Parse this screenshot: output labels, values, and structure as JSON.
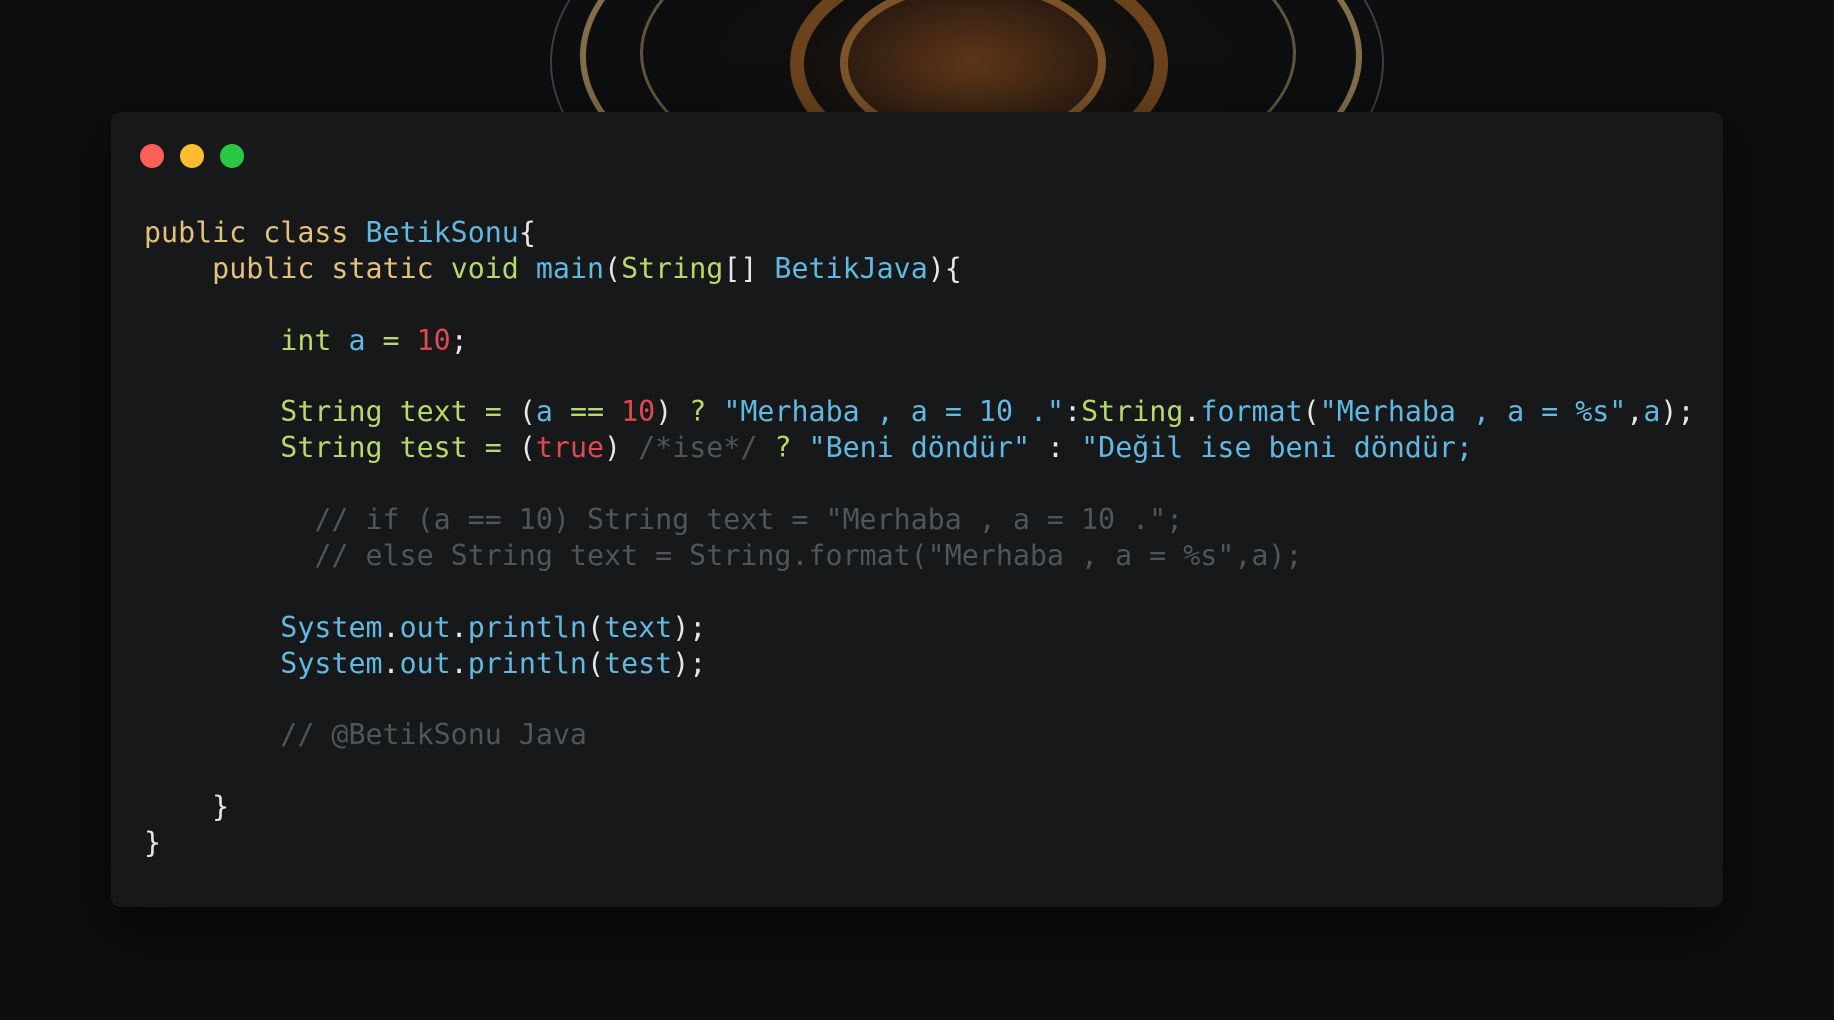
{
  "code_lines": [
    [
      [
        "kw",
        "public"
      ],
      [
        "pl",
        " "
      ],
      [
        "kw",
        "class"
      ],
      [
        "pl",
        " "
      ],
      [
        "id",
        "BetikSonu"
      ],
      [
        "pl",
        "{"
      ]
    ],
    [
      [
        "pl",
        "    "
      ],
      [
        "kw",
        "public"
      ],
      [
        "pl",
        " "
      ],
      [
        "kw",
        "static"
      ],
      [
        "pl",
        " "
      ],
      [
        "ty",
        "void"
      ],
      [
        "pl",
        " "
      ],
      [
        "fn",
        "main"
      ],
      [
        "pl",
        "("
      ],
      [
        "ty",
        "String"
      ],
      [
        "pl",
        "[] "
      ],
      [
        "id",
        "BetikJava"
      ],
      [
        "pl",
        "){"
      ]
    ],
    [],
    [
      [
        "pl",
        "        "
      ],
      [
        "ty",
        "int"
      ],
      [
        "pl",
        " "
      ],
      [
        "id",
        "a"
      ],
      [
        "pl",
        " "
      ],
      [
        "op",
        "="
      ],
      [
        "pl",
        " "
      ],
      [
        "nu",
        "10"
      ],
      [
        "pl",
        ";"
      ]
    ],
    [],
    [
      [
        "pl",
        "        "
      ],
      [
        "ty",
        "String"
      ],
      [
        "pl",
        " "
      ],
      [
        "ty",
        "text"
      ],
      [
        "pl",
        " "
      ],
      [
        "op",
        "="
      ],
      [
        "pl",
        " ("
      ],
      [
        "id",
        "a"
      ],
      [
        "pl",
        " "
      ],
      [
        "op",
        "=="
      ],
      [
        "pl",
        " "
      ],
      [
        "nu",
        "10"
      ],
      [
        "pl",
        ") "
      ],
      [
        "op",
        "?"
      ],
      [
        "pl",
        " "
      ],
      [
        "st",
        "\"Merhaba , a = 10 .\""
      ],
      [
        "pl",
        ":"
      ],
      [
        "ty",
        "String"
      ],
      [
        "pl",
        "."
      ],
      [
        "fn",
        "format"
      ],
      [
        "pl",
        "("
      ],
      [
        "st",
        "\"Merhaba , a = %s\""
      ],
      [
        "pl",
        ","
      ],
      [
        "id",
        "a"
      ],
      [
        "pl",
        ");"
      ]
    ],
    [
      [
        "pl",
        "        "
      ],
      [
        "ty",
        "String"
      ],
      [
        "pl",
        " "
      ],
      [
        "ty",
        "test"
      ],
      [
        "pl",
        " "
      ],
      [
        "op",
        "="
      ],
      [
        "pl",
        " ("
      ],
      [
        "nu",
        "true"
      ],
      [
        "pl",
        ") "
      ],
      [
        "cm",
        "/*ise*/"
      ],
      [
        "pl",
        " "
      ],
      [
        "op",
        "?"
      ],
      [
        "pl",
        " "
      ],
      [
        "st",
        "\"Beni döndür\""
      ],
      [
        "pl",
        " : "
      ],
      [
        "st",
        "\"Değil ise beni döndür;"
      ]
    ],
    [],
    [
      [
        "pl",
        "          "
      ],
      [
        "cm",
        "// if (a == 10) String text = \"Merhaba , a = 10 .\";"
      ]
    ],
    [
      [
        "pl",
        "          "
      ],
      [
        "cm",
        "// else String text = String.format(\"Merhaba , a = %s\",a);"
      ]
    ],
    [],
    [
      [
        "pl",
        "        "
      ],
      [
        "id",
        "System"
      ],
      [
        "pl",
        "."
      ],
      [
        "id",
        "out"
      ],
      [
        "pl",
        "."
      ],
      [
        "fn",
        "println"
      ],
      [
        "pl",
        "("
      ],
      [
        "id",
        "text"
      ],
      [
        "pl",
        ");"
      ]
    ],
    [
      [
        "pl",
        "        "
      ],
      [
        "id",
        "System"
      ],
      [
        "pl",
        "."
      ],
      [
        "id",
        "out"
      ],
      [
        "pl",
        "."
      ],
      [
        "fn",
        "println"
      ],
      [
        "pl",
        "("
      ],
      [
        "id",
        "test"
      ],
      [
        "pl",
        ");"
      ]
    ],
    [],
    [
      [
        "pl",
        "        "
      ],
      [
        "cm",
        "// @BetikSonu Java"
      ]
    ],
    [],
    [
      [
        "pl",
        "    }"
      ]
    ],
    [
      [
        "pl",
        "}"
      ]
    ]
  ],
  "colors": {
    "keyword": "#e5c07b",
    "type": "#b7d96b",
    "identifier": "#61b8e0",
    "number": "#e0484f",
    "comment": "#4f5558",
    "plain": "#e6e6e6",
    "window_background": "#16181a",
    "traffic_red": "#fe5f57",
    "traffic_yellow": "#febc2e",
    "traffic_green": "#28c840"
  }
}
